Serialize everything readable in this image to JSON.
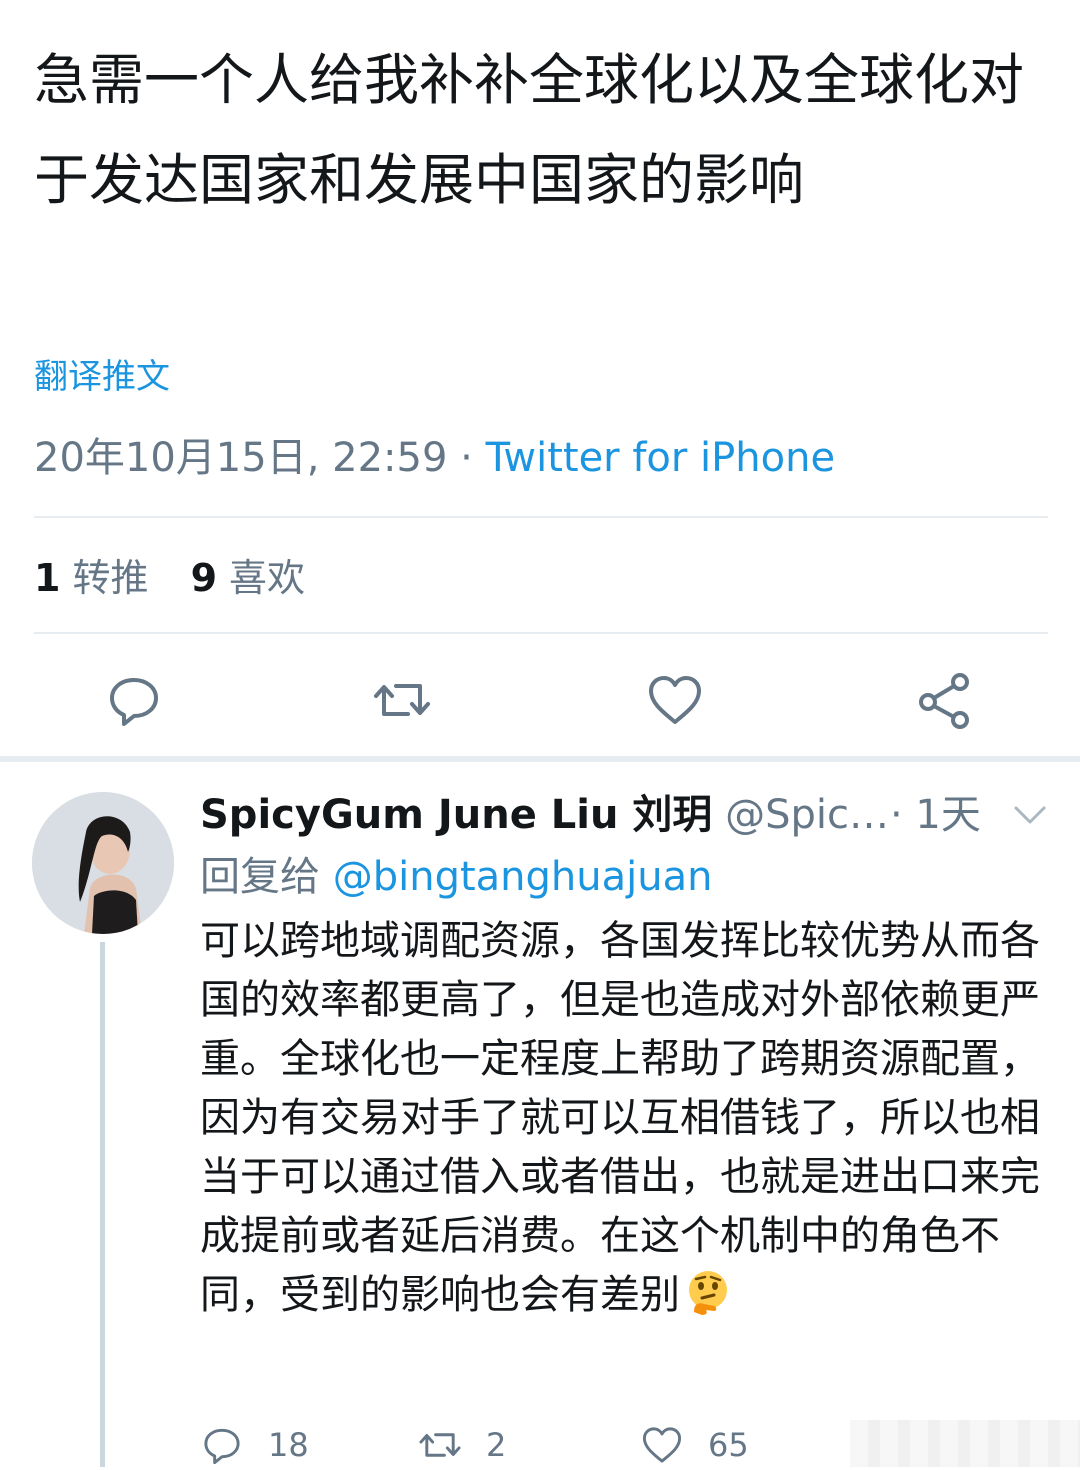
{
  "tweet": {
    "text": "急需一个人给我补补全球化以及全球化对于发达国家和发展中国家的影响",
    "translate_label": "翻译推文",
    "timestamp": "20年10月15日, 22:59",
    "separator": " · ",
    "source": "Twitter for iPhone",
    "retweet_count": "1",
    "retweet_label": "转推",
    "like_count": "9",
    "like_label": "喜欢"
  },
  "actions": {
    "reply_icon": "reply-icon",
    "retweet_icon": "retweet-icon",
    "like_icon": "heart-icon",
    "share_icon": "share-icon"
  },
  "reply": {
    "display_name": "SpicyGum June Liu 刘玥",
    "handle": "@Spic…",
    "time": "· 1天",
    "reply_to_label": "回复给",
    "reply_to_handle": "@bingtanghuajuan",
    "body": "可以跨地域调配资源，各国发挥比较优势从而各国的效率都更高了，但是也造成对外部依赖更严重。全球化也一定程度上帮助了跨期资源配置，因为有交易对手了就可以互相借钱了，所以也相当于可以通过借入或者借出，也就是进出口来完成提前或者延后消费。在这个机制中的角色不同，受到的影响也会有差别",
    "emoji": "thinking-face",
    "reply_count": "18",
    "retweet_count": "2",
    "like_count": "65"
  },
  "colors": {
    "link": "#1b95e0",
    "muted": "#657786",
    "text": "#14171a",
    "divider": "#e6ecf0"
  }
}
